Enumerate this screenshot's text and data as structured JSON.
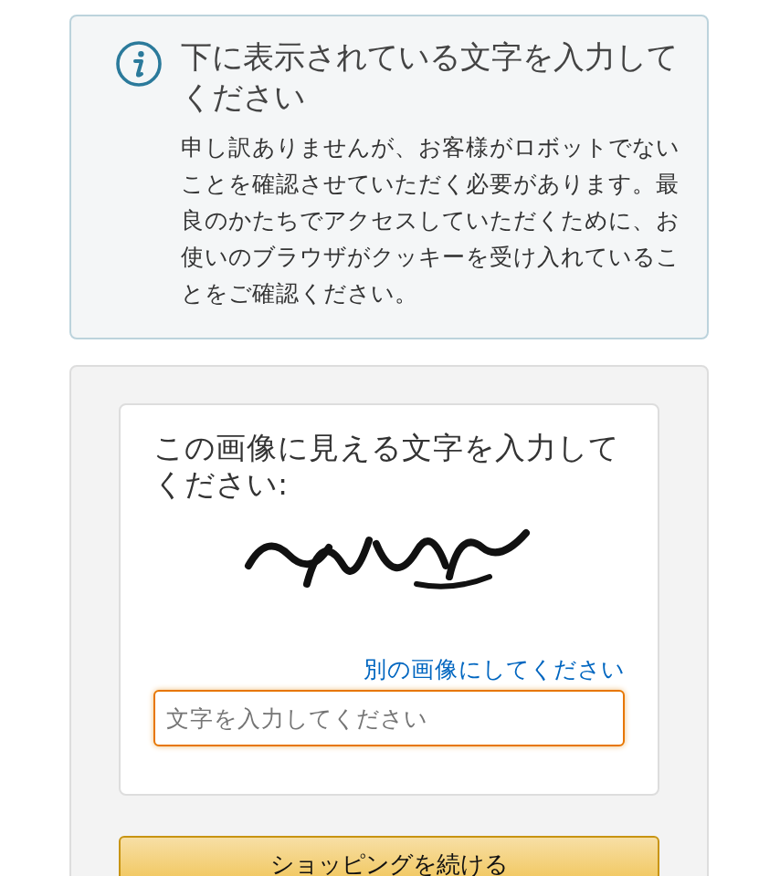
{
  "alert": {
    "title": "下に表示されている文字を入力してください",
    "message": "申し訳ありませんが、お客様がロボットでないことを確認させていただく必要があります。最良のかたちでアクセスしていただくために、お使いのブラウザがクッキーを受け入れていることをご確認ください。"
  },
  "captcha": {
    "heading": "この画像に見える文字を入力してください:",
    "refresh_link": "別の画像にしてください",
    "input": {
      "placeholder": "文字を入力してください"
    }
  },
  "button": "ショッピングを続ける"
}
